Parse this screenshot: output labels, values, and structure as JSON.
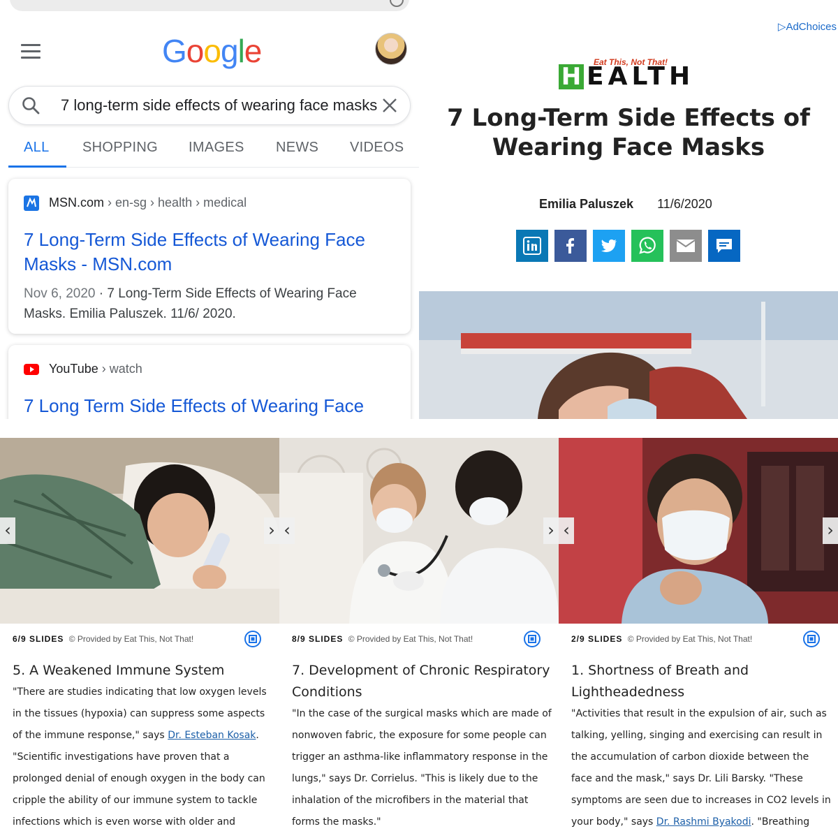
{
  "google": {
    "logo": [
      "G",
      "o",
      "o",
      "g",
      "l",
      "e"
    ],
    "search": {
      "value": "7 long-term side effects of wearing face masks"
    },
    "tabs": [
      "ALL",
      "SHOPPING",
      "IMAGES",
      "NEWS",
      "VIDEOS"
    ],
    "active_tab": "ALL",
    "results": [
      {
        "site": "MSN.com",
        "path": " › en-sg › health › medical",
        "title": "7 Long-Term Side Effects of Wearing Face Masks - MSN.com",
        "date": "Nov 6, 2020",
        "snippet": " · 7 Long-Term Side Effects of Wearing Face Masks. Emilia Paluszek. 11/6/ 2020."
      },
      {
        "site": "YouTube",
        "path": " › watch",
        "title": "7 Long Term Side Effects of Wearing Face"
      }
    ]
  },
  "article": {
    "adchoices": "AdChoices",
    "brand_tagline": "Eat This, Not That!",
    "brand_h": "H",
    "brand_rest": "EALTH",
    "title": "7 Long-Term Side Effects of Wearing Face Masks",
    "author": "Emilia Paluszek",
    "date": "11/6/2020",
    "share": [
      {
        "icon": "linkedin-icon",
        "glyph": "in",
        "color": "#0a78b5"
      },
      {
        "icon": "facebook-icon",
        "glyph": "f",
        "color": "#3b5a9a"
      },
      {
        "icon": "twitter-icon",
        "glyph": "t",
        "color": "#1da1f2"
      },
      {
        "icon": "whatsapp-icon",
        "glyph": "w",
        "color": "#25c15a"
      },
      {
        "icon": "email-icon",
        "glyph": "e",
        "color": "#8d8d8d"
      },
      {
        "icon": "comment-icon",
        "glyph": "c",
        "color": "#0667c2"
      }
    ]
  },
  "slides": [
    {
      "count": "6/9 SLIDES",
      "provider": "© Provided by Eat This, Not That!",
      "title": "5. A Weakened Immune System",
      "body_before": "\"There are studies indicating that low oxygen levels in the tissues (hypoxia) can suppress some aspects of the immune response,\" says ",
      "link": "Dr. Esteban Kosak",
      "body_after": ". \"Scientific investigations have proven that a prolonged denial of enough oxygen in the body can cripple the ability of our immune system to tackle infections which is even worse with older and"
    },
    {
      "count": "8/9 SLIDES",
      "provider": "© Provided by Eat This, Not That!",
      "title": "7. Development of Chronic Respiratory Conditions",
      "body_before": "\"In the case of the surgical masks which are made of nonwoven fabric, the exposure for some people can trigger an asthma-like inflammatory response in the lungs,\" says Dr. Corrielus. \"This is likely due to the inhalation of the microfibers in the material that forms the masks.\"",
      "link": "",
      "body_after": ""
    },
    {
      "count": "2/9 SLIDES",
      "provider": "© Provided by Eat This, Not That!",
      "title": "1. Shortness of Breath and Lightheadedness",
      "body_before": "\"Activities that result in the expulsion of air, such as talking, yelling, singing and exercising can result in the accumulation of carbon dioxide between the face and the mask,\" says Dr. Lili Barsky. \"These symptoms are seen due to increases in CO2 levels in your body,\" says ",
      "link": "Dr. Rashmi Byakodi",
      "body_after": ". \"Breathing over exhaled air"
    }
  ]
}
